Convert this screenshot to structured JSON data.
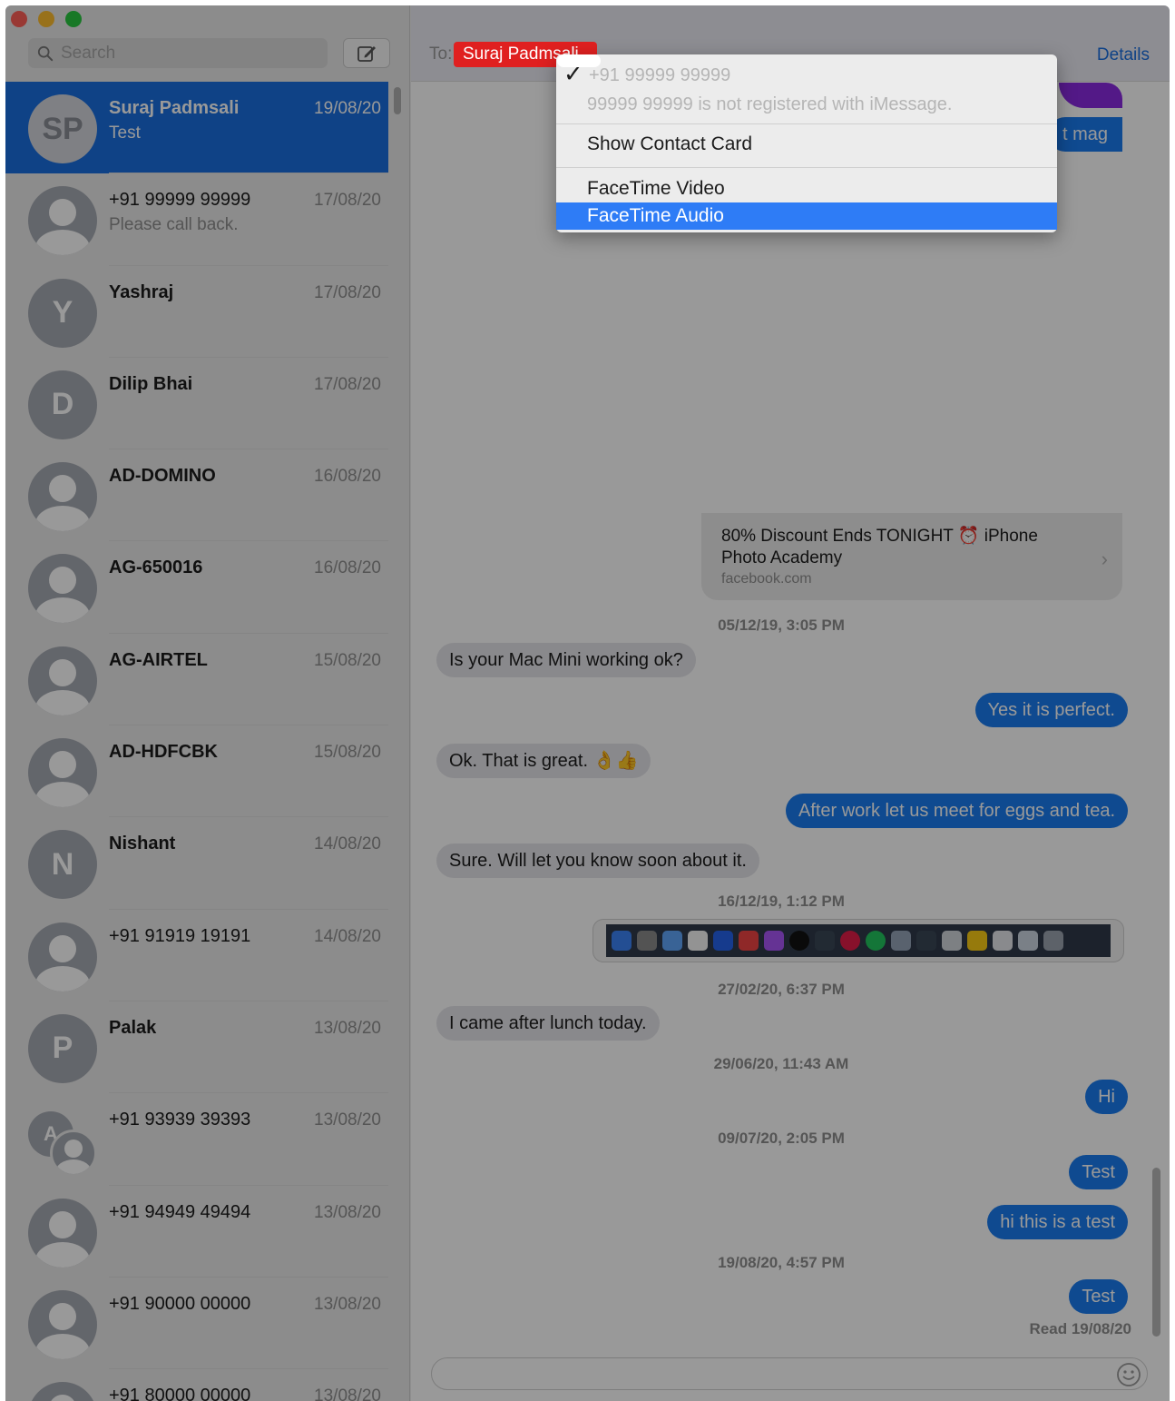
{
  "sidebar": {
    "search_placeholder": "Search",
    "conversations": [
      {
        "name": "Suraj Padmsali",
        "initials": "SP",
        "date": "19/08/20",
        "preview": "Test",
        "avatar": "initials",
        "selected": true
      },
      {
        "name": "+91 99999 99999",
        "initials": "",
        "date": "17/08/20",
        "preview": "Please call back.",
        "avatar": "person"
      },
      {
        "name": "Yashraj",
        "initials": "Y",
        "date": "17/08/20",
        "preview": "",
        "avatar": "initials"
      },
      {
        "name": "Dilip Bhai",
        "initials": "D",
        "date": "17/08/20",
        "preview": "",
        "avatar": "initials"
      },
      {
        "name": "AD-DOMINO",
        "initials": "",
        "date": "16/08/20",
        "preview": "",
        "avatar": "person"
      },
      {
        "name": "AG-650016",
        "initials": "",
        "date": "16/08/20",
        "preview": "",
        "avatar": "person"
      },
      {
        "name": "AG-AIRTEL",
        "initials": "",
        "date": "15/08/20",
        "preview": "",
        "avatar": "person"
      },
      {
        "name": "AD-HDFCBK",
        "initials": "",
        "date": "15/08/20",
        "preview": "",
        "avatar": "person"
      },
      {
        "name": "Nishant",
        "initials": "N",
        "date": "14/08/20",
        "preview": "",
        "avatar": "initials"
      },
      {
        "name": "+91 91919 19191",
        "initials": "",
        "date": "14/08/20",
        "preview": "",
        "avatar": "person"
      },
      {
        "name": "Palak",
        "initials": "P",
        "date": "13/08/20",
        "preview": "",
        "avatar": "initials"
      },
      {
        "name": "+91 93939 39393",
        "initials": "A",
        "date": "13/08/20",
        "preview": "",
        "avatar": "group"
      },
      {
        "name": "+91 94949 49494",
        "initials": "",
        "date": "13/08/20",
        "preview": "",
        "avatar": "person"
      },
      {
        "name": "+91 90000 00000",
        "initials": "",
        "date": "13/08/20",
        "preview": "",
        "avatar": "person"
      },
      {
        "name": "+91 80000 00000",
        "initials": "",
        "date": "13/08/20",
        "preview": "",
        "avatar": "person"
      }
    ]
  },
  "header": {
    "to_label": "To:",
    "recipient": "Suraj Padmsali",
    "details": "Details"
  },
  "link_preview": {
    "bubble_text": "t mag",
    "title": "80% Discount Ends TONIGHT ⏰ iPhone Photo Academy",
    "site": "facebook.com"
  },
  "messages": [
    {
      "kind": "stamp",
      "text": "05/12/19, 3:05 PM"
    },
    {
      "kind": "in",
      "text": "Is your Mac Mini working ok?"
    },
    {
      "kind": "out",
      "text": "Yes it is perfect."
    },
    {
      "kind": "in",
      "text": "Ok. That is great. 👌👍"
    },
    {
      "kind": "out",
      "text": "After work let us meet for eggs and tea."
    },
    {
      "kind": "in",
      "text": "Sure. Will let you know soon about it."
    },
    {
      "kind": "stamp",
      "text": "16/12/19, 1:12 PM"
    },
    {
      "kind": "stamp",
      "text": "27/02/20, 6:37 PM"
    },
    {
      "kind": "in",
      "text": "I came after lunch today."
    },
    {
      "kind": "stamp",
      "text": "29/06/20, 11:43 AM"
    },
    {
      "kind": "out",
      "text": "Hi"
    },
    {
      "kind": "stamp",
      "text": "09/07/20, 2:05 PM"
    },
    {
      "kind": "out",
      "text": "Test"
    },
    {
      "kind": "out",
      "text": "hi this is a test"
    },
    {
      "kind": "stamp",
      "text": "19/08/20, 4:57 PM"
    },
    {
      "kind": "out",
      "text": "Test"
    }
  ],
  "read_receipt": "Read 19/08/20",
  "menu": {
    "phone": "+91 99999 99999",
    "phone_note": "99999 99999    is not registered with iMessage.",
    "items": [
      "Show Contact Card",
      "FaceTime Video",
      "FaceTime Audio"
    ],
    "active_index": 2
  },
  "colors": {
    "selection": "#1a6fe0",
    "outgoing_bubble": "#1a7cf0",
    "menu_highlight": "#2e7cf6",
    "recipient_chip": "#e02020"
  }
}
